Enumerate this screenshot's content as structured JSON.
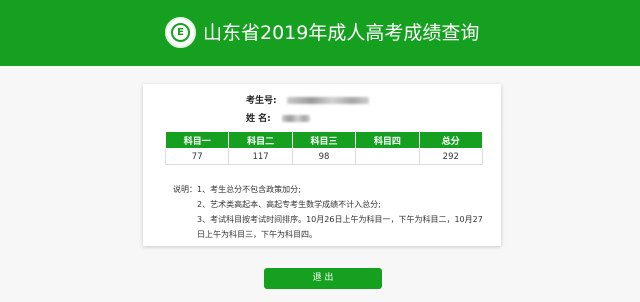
{
  "header": {
    "title": "山东省2019年成人高考成绩查询",
    "logo_text": "E",
    "color": "#16a01f"
  },
  "candidate": {
    "exam_no_label": "考生号:",
    "name_label": "姓 名:"
  },
  "scores": {
    "headers": [
      "科目一",
      "科目二",
      "科目三",
      "科目四",
      "总分"
    ],
    "values": [
      "77",
      "117",
      "98",
      "",
      "292"
    ]
  },
  "notes": {
    "lead": "说明：",
    "items": [
      "1、考生总分不包含政策加分;",
      "2、艺术类高起本、高起专考生数学成绩不计入总分;",
      "3、考试科目按考试时间排序。10月26日上午为科目一，下午为科目二，10月27",
      "日上午为科目三，下午为科目四。"
    ]
  },
  "actions": {
    "exit_label": "退 出"
  }
}
